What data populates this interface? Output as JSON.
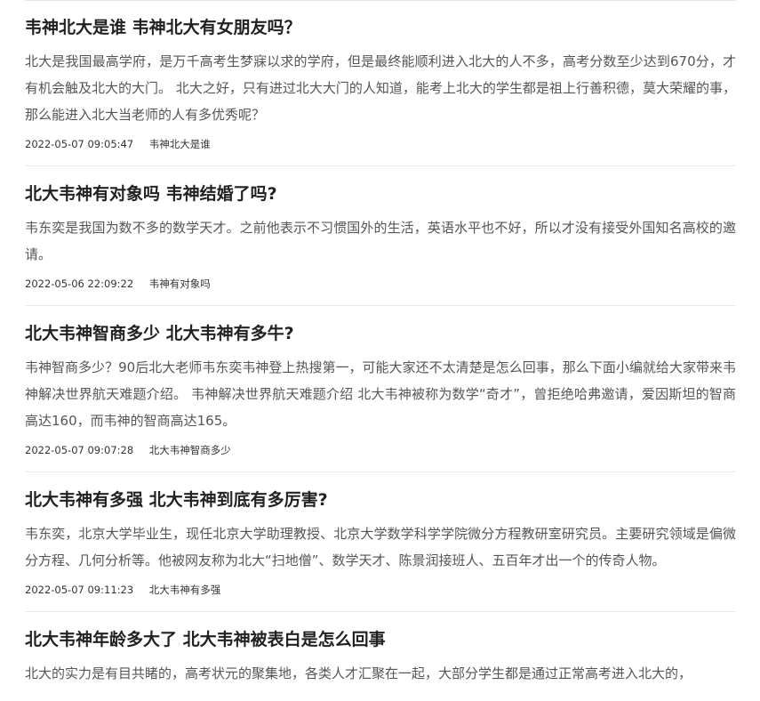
{
  "articles": [
    {
      "title": "韦神北大是谁 韦神北大有女朋友吗？",
      "summary": "北大是我国最高学府，是万千高考生梦寐以求的学府，但是最终能顺利进入北大的人不多，高考分数至少达到670分，才有机会触及北大的大门。 北大之好，只有进过北大大门的人知道，能考上北大的学生都是祖上行善积德，莫大荣耀的事，那么能进入北大当老师的人有多优秀呢？",
      "date": "2022-05-07 09:05:47",
      "tag": "韦神北大是谁"
    },
    {
      "title": "北大韦神有对象吗 韦神结婚了吗?",
      "summary": "韦东奕是我国为数不多的数学天才。之前他表示不习惯国外的生活，英语水平也不好，所以才没有接受外国知名高校的邀请。",
      "date": "2022-05-06 22:09:22",
      "tag": "韦神有对象吗"
    },
    {
      "title": "北大韦神智商多少 北大韦神有多牛?",
      "summary": "韦神智商多少？90后北大老师韦东奕韦神登上热搜第一，可能大家还不太清楚是怎么回事，那么下面小编就给大家带来韦神解决世界航天难题介绍。 韦神解决世界航天难题介绍 北大韦神被称为数学“奇才”，曾拒绝哈弗邀请，爱因斯坦的智商高达160，而韦神的智商高达165。",
      "date": "2022-05-07 09:07:28",
      "tag": "北大韦神智商多少"
    },
    {
      "title": "北大韦神有多强 北大韦神到底有多厉害?",
      "summary": "韦东奕，北京大学毕业生，现任北京大学助理教授、北京大学数学科学学院微分方程教研室研究员。主要研究领域是偏微分方程、几何分析等。他被网友称为北大“扫地僧”、数学天才、陈景润接班人、五百年才出一个的传奇人物。",
      "date": "2022-05-07 09:11:23",
      "tag": "北大韦神有多强"
    },
    {
      "title": "北大韦神年龄多大了 北大韦神被表白是怎么回事",
      "summary": "北大的实力是有目共睹的，高考状元的聚集地，各类人才汇聚在一起，大部分学生都是通过正常高考进入北大的，",
      "date": "",
      "tag": ""
    }
  ]
}
